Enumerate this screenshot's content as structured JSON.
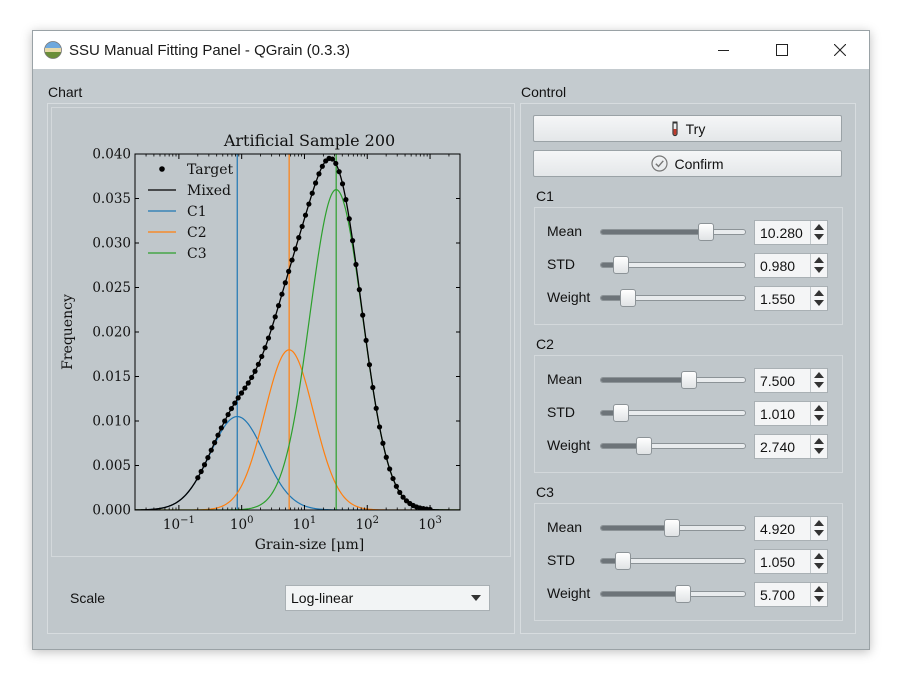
{
  "window": {
    "title": "SSU Manual Fitting Panel - QGrain (0.3.3)"
  },
  "chart_group": {
    "label": "Chart"
  },
  "control_group": {
    "label": "Control"
  },
  "scale": {
    "label": "Scale",
    "value": "Log-linear"
  },
  "buttons": {
    "try": "Try",
    "confirm": "Confirm"
  },
  "components": [
    {
      "name": "C1",
      "params": [
        {
          "label": "Mean",
          "value": "10.280",
          "position": 0.73
        },
        {
          "label": "STD",
          "value": "0.980",
          "position": 0.14
        },
        {
          "label": "Weight",
          "value": "1.550",
          "position": 0.19
        }
      ]
    },
    {
      "name": "C2",
      "params": [
        {
          "label": "Mean",
          "value": "7.500",
          "position": 0.61
        },
        {
          "label": "STD",
          "value": "1.010",
          "position": 0.14
        },
        {
          "label": "Weight",
          "value": "2.740",
          "position": 0.3
        }
      ]
    },
    {
      "name": "C3",
      "params": [
        {
          "label": "Mean",
          "value": "4.920",
          "position": 0.49
        },
        {
          "label": "STD",
          "value": "1.050",
          "position": 0.15
        },
        {
          "label": "Weight",
          "value": "5.700",
          "position": 0.57
        }
      ]
    }
  ],
  "colors": {
    "C1": "#1f77b4",
    "C2": "#ff7f0e",
    "C3": "#2ca02c",
    "mixed": "#000000"
  },
  "chart_data": {
    "type": "line",
    "title": "Artificial Sample 200",
    "xlabel": "Grain-size [μm]",
    "ylabel": "Frequency",
    "xscale": "log",
    "xlim": [
      0.02,
      3000
    ],
    "ylim": [
      0,
      0.04
    ],
    "yticks": [
      "0.000",
      "0.005",
      "0.010",
      "0.015",
      "0.020",
      "0.025",
      "0.030",
      "0.035",
      "0.040"
    ],
    "xticks": [
      {
        "value": 0.1,
        "base": "10",
        "exp": "−1"
      },
      {
        "value": 1,
        "base": "10",
        "exp": "0"
      },
      {
        "value": 10,
        "base": "10",
        "exp": "1"
      },
      {
        "value": 100,
        "base": "10",
        "exp": "2"
      },
      {
        "value": 1000,
        "base": "10",
        "exp": "3"
      }
    ],
    "legend": [
      "Target",
      "Mixed",
      "C1",
      "C2",
      "C3"
    ],
    "legend_position": "top-left",
    "components": [
      {
        "name": "C1",
        "mode": 0.85,
        "peak": 0.0105,
        "sigma": 0.43,
        "vline": 0.85
      },
      {
        "name": "C2",
        "mode": 5.7,
        "peak": 0.018,
        "sigma": 0.39,
        "vline": 5.7
      },
      {
        "name": "C3",
        "mode": 32,
        "peak": 0.036,
        "sigma": 0.42,
        "vline": 32
      }
    ],
    "target_x_range": [
      0.2,
      1000
    ],
    "target_count": 70
  }
}
